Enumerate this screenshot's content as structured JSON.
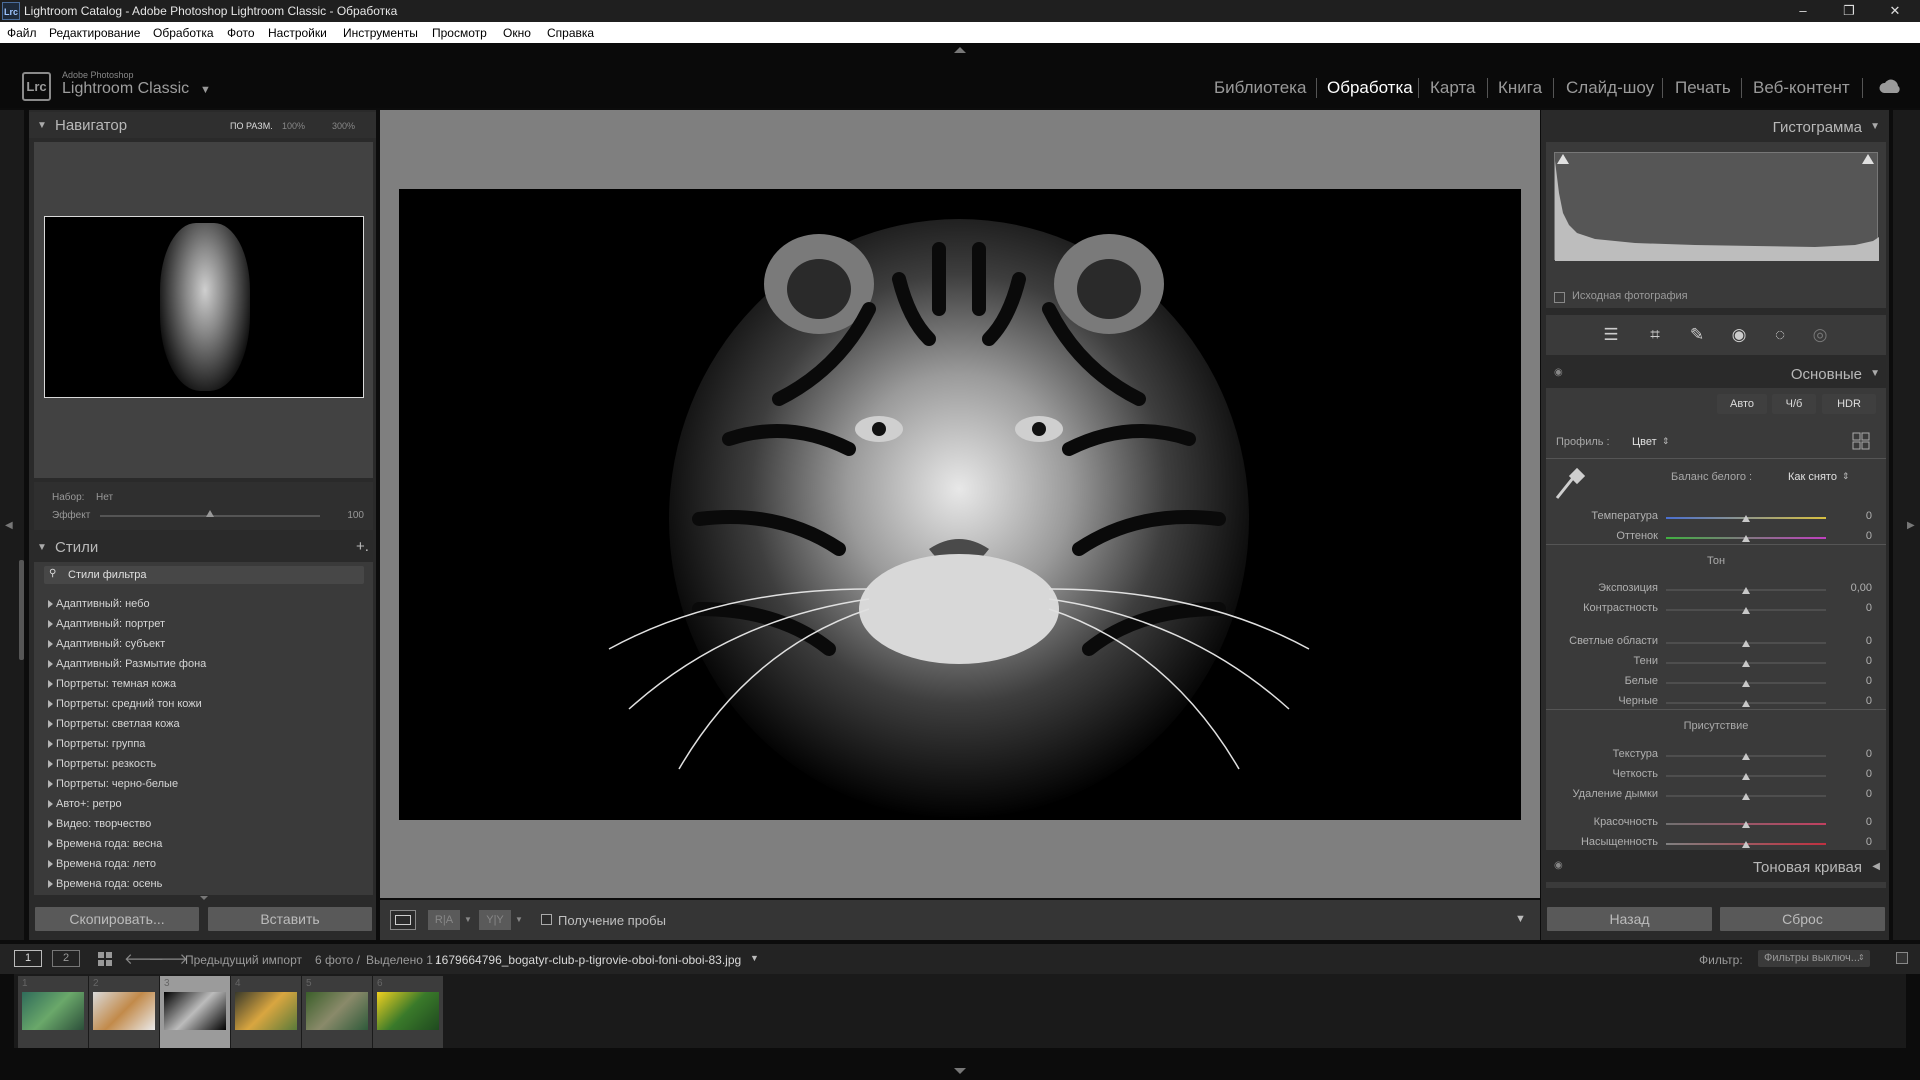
{
  "window": {
    "app_icon": "Lrc",
    "title": "Lightroom Catalog - Adobe Photoshop Lightroom Classic - Обработка",
    "controls": [
      "–",
      "❐",
      "✕"
    ]
  },
  "menu": [
    "Файл",
    "Редактирование",
    "Обработка",
    "Фото",
    "Настройки",
    "Инструменты",
    "Просмотр",
    "Окно",
    "Справка"
  ],
  "identity": {
    "logo": "Lrc",
    "brand_small": "Adobe Photoshop",
    "brand_main": "Lightroom Classic"
  },
  "modules": [
    "Библиотека",
    "Обработка",
    "Карта",
    "Книга",
    "Слайд-шоу",
    "Печать",
    "Веб-контент"
  ],
  "active_module": "Обработка",
  "navigator": {
    "title": "Навигатор",
    "zoom_fit": "ПО РАЗМ.",
    "zoom_100": "100%",
    "zoom_300": "300%"
  },
  "style_amount": {
    "set_label": "Набор:",
    "set_value": "Нет",
    "effect_label": "Эффект",
    "effect_value": "100",
    "effect_fraction": 0.5
  },
  "styles": {
    "title": "Стили",
    "add": "+.",
    "filter_placeholder": "Стили фильтра",
    "items": [
      "Адаптивный: небо",
      "Адаптивный: портрет",
      "Адаптивный: субъект",
      "Адаптивный: Размытие фона",
      "Портреты: темная кожа",
      "Портреты: средний тон кожи",
      "Портреты: светлая кожа",
      "Портреты: группа",
      "Портреты: резкость",
      "Портреты: черно-белые",
      "Авто+: ретро",
      "Видео: творчество",
      "Времена года: весна",
      "Времена года: лето",
      "Времена года: осень"
    ]
  },
  "left_buttons": {
    "copy": "Скопировать...",
    "paste": "Вставить"
  },
  "toolbar": {
    "view_ra": "R|A",
    "view_yy": "Y|Y",
    "soft_proof": "Получение пробы"
  },
  "histogram": {
    "title": "Гистограмма",
    "original_photo": "Исходная фотография"
  },
  "tools": [
    "sliders-icon",
    "crop-icon",
    "heal-icon",
    "redeye-icon",
    "mask-icon",
    "gradient-icon"
  ],
  "basic": {
    "title": "Основные",
    "treatment_buttons": [
      "Авто",
      "Ч/б",
      "HDR"
    ],
    "profile_label": "Профиль :",
    "profile_value": "Цвет",
    "wb_label": "Баланс белого :",
    "wb_value": "Как снято",
    "wb_sliders": [
      {
        "label": "Температура",
        "value": "0"
      },
      {
        "label": "Оттенок",
        "value": "0"
      }
    ],
    "tone_title": "Тон",
    "tone_sliders_a": [
      {
        "label": "Экспозиция",
        "value": "0,00"
      },
      {
        "label": "Контрастность",
        "value": "0"
      }
    ],
    "tone_sliders_b": [
      {
        "label": "Светлые области",
        "value": "0"
      },
      {
        "label": "Тени",
        "value": "0"
      },
      {
        "label": "Белые",
        "value": "0"
      },
      {
        "label": "Черные",
        "value": "0"
      }
    ],
    "presence_title": "Присутствие",
    "presence_sliders_a": [
      {
        "label": "Текстура",
        "value": "0"
      },
      {
        "label": "Четкость",
        "value": "0"
      },
      {
        "label": "Удаление дымки",
        "value": "0"
      }
    ],
    "presence_sliders_b": [
      {
        "label": "Красочность",
        "value": "0"
      },
      {
        "label": "Насыщенность",
        "value": "0"
      }
    ]
  },
  "tone_curve": {
    "title": "Тоновая кривая"
  },
  "right_buttons": {
    "back": "Назад",
    "reset": "Сброс"
  },
  "filmbar": {
    "view1": "1",
    "view2": "2",
    "source": "Предыдущий импорт",
    "count": "6 фото /",
    "selected": "Выделено 1 /",
    "filename": "1679664796_bogatyr-club-p-tigrovie-oboi-foni-oboi-83.jpg",
    "filter_label": "Фильтр:",
    "filter_value": "Фильтры выключ..."
  },
  "filmstrip": [
    {
      "num": "1",
      "colors": [
        "#2f6b5a",
        "#6aa86a",
        "#2c4f3a"
      ]
    },
    {
      "num": "2",
      "colors": [
        "#d9d9d9",
        "#c28a4a",
        "#eaeaea"
      ]
    },
    {
      "num": "3",
      "colors": [
        "#000000",
        "#bcbcbc",
        "#000000"
      ],
      "selected": true
    },
    {
      "num": "4",
      "colors": [
        "#3a3a2a",
        "#d9a640",
        "#5a7a3a"
      ]
    },
    {
      "num": "5",
      "colors": [
        "#3b5f2a",
        "#8a8a6a",
        "#2f5a3a"
      ]
    },
    {
      "num": "6",
      "colors": [
        "#f0d020",
        "#3a7a2a",
        "#1f4a1f"
      ]
    }
  ]
}
